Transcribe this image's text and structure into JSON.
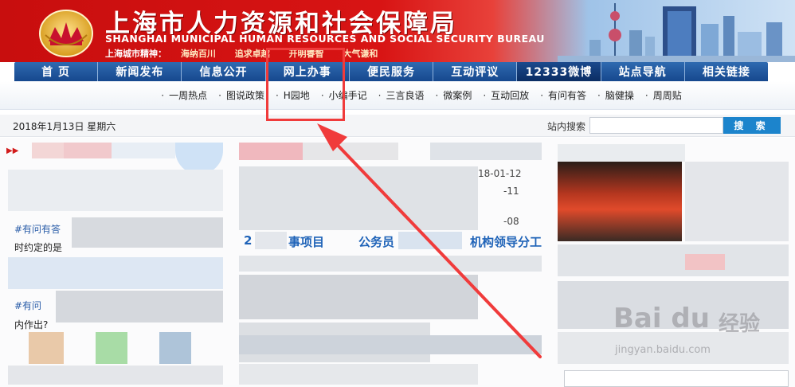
{
  "header": {
    "title_cn": "上海市人力资源和社会保障局",
    "title_en": "SHANGHAI MUNICIPAL HUMAN RESOURCES AND SOCIAL SECURITY BUREAU",
    "spirit_label": "上海城市精神：",
    "spirit_mottos": [
      "海纳百川",
      "追求卓越",
      "开明睿智",
      "大气谦和"
    ]
  },
  "nav": {
    "items": [
      "首 页",
      "新闻发布",
      "信息公开",
      "网上办事",
      "便民服务",
      "互动评议",
      "12333微博",
      "站点导航",
      "相关链接"
    ]
  },
  "subnav": {
    "items": [
      "一周热点",
      "图说政策",
      "H园地",
      "小编手记",
      "三言良语",
      "微案例",
      "互动回放",
      "有问有答",
      "脑健操",
      "周周贴"
    ]
  },
  "datebar": {
    "date": "2018年1月13日  星期六",
    "search_label": "站内搜索",
    "search_value": "",
    "search_button": "搜 索"
  },
  "content": {
    "left_tag_1": "#有问有答",
    "left_text_1": "时约定的是",
    "left_tag_2": "#有问",
    "left_text_2": "内作出?",
    "section_head_1": "2",
    "section_head_2": "事项目",
    "section_head_3": "公务员",
    "section_head_4": "机构领导分工",
    "date_1": "18-01-12",
    "date_2": "-11",
    "date_3": "-08"
  },
  "watermark": {
    "logo": "Bai du",
    "cn": "经验",
    "url": "jingyan.baidu.com"
  },
  "colors": {
    "banner_red": "#d81414",
    "nav_blue": "#1f5aa3",
    "highlight": "#f03b3b",
    "search_button": "#1c84cc"
  }
}
